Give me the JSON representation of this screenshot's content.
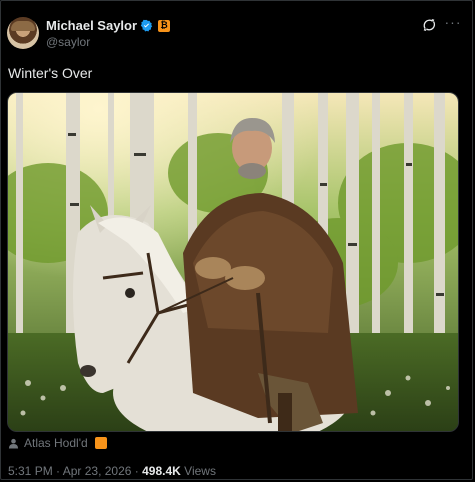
{
  "author": {
    "display_name": "Michael Saylor",
    "handle": "@saylor",
    "verified_icon": "verified-badge-icon",
    "affiliate_badge": "bitcoin-badge",
    "affiliate_badge_text": "₿"
  },
  "actions": {
    "grok_icon": "grok-icon",
    "more_icon": "more-icon",
    "more_label": "···"
  },
  "tweet": {
    "text": "Winter's Over"
  },
  "media": {
    "description_icon": "photo-media"
  },
  "attribution": {
    "name": "Atlas Hodl'd",
    "icon": "person-icon"
  },
  "meta": {
    "time": "5:31 PM",
    "separator": "·",
    "date": "Apr 23, 2026",
    "views_count": "498.4K",
    "views_label": "Views"
  },
  "colors": {
    "background": "#000000",
    "text_primary": "#e7e9ea",
    "text_secondary": "#71767b",
    "verified_blue": "#1d9bf0",
    "bitcoin_orange": "#f7931a"
  }
}
